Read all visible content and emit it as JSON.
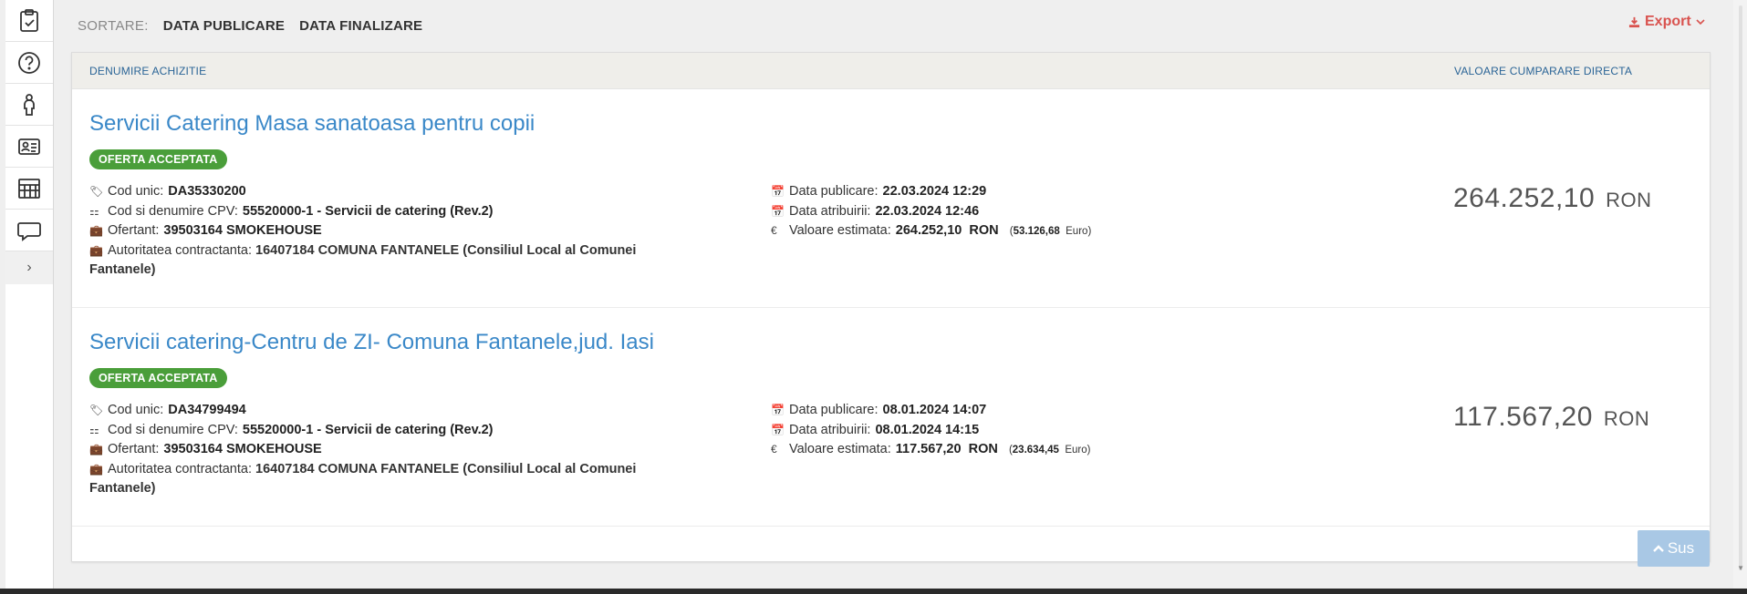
{
  "sidebar": {
    "items": [
      {
        "icon": "clipboard-check-icon"
      },
      {
        "icon": "help-circle-icon"
      },
      {
        "icon": "person-icon"
      },
      {
        "icon": "id-card-icon"
      },
      {
        "icon": "calendar-grid-icon"
      },
      {
        "icon": "chat-bubble-icon"
      }
    ],
    "toggle": "›"
  },
  "sort": {
    "label": "SORTARE:",
    "options": [
      "DATA PUBLICARE",
      "DATA FINALIZARE"
    ]
  },
  "export": {
    "label": "Export",
    "color": "#d9534f"
  },
  "table": {
    "col_name": "DENUMIRE ACHIZITIE",
    "col_value": "VALOARE CUMPARARE DIRECTA"
  },
  "rows": [
    {
      "title": "Servicii Catering Masa sanatoasa pentru copii",
      "status": "OFERTA ACCEPTATA",
      "cod_label": "Cod unic:",
      "cod": "DA35330200",
      "cpv_label": "Cod si denumire CPV:",
      "cpv": "55520000-1 - Servicii de catering (Rev.2)",
      "ofertant_label": "Ofertant:",
      "ofertant": "39503164 SMOKEHOUSE",
      "autoritate_label": "Autoritatea contractanta:",
      "autoritate": "16407184 COMUNA FANTANELE (Consiliul Local al Comunei Fantanele)",
      "publicare_label": "Data publicare:",
      "publicare": "22.03.2024 12:29",
      "atribuire_label": "Data atribuirii:",
      "atribuire": "22.03.2024 12:46",
      "valoare_label": "Valoare estimata:",
      "valoare": "264.252,10",
      "valoare_cur": "RON",
      "valoare_euro": "53.126,68",
      "euro_label": "Euro",
      "price": "264.252,10",
      "price_cur": "RON"
    },
    {
      "title": "Servicii catering-Centru de ZI- Comuna Fantanele,jud. Iasi",
      "status": "OFERTA ACCEPTATA",
      "cod_label": "Cod unic:",
      "cod": "DA34799494",
      "cpv_label": "Cod si denumire CPV:",
      "cpv": "55520000-1 - Servicii de catering (Rev.2)",
      "ofertant_label": "Ofertant:",
      "ofertant": "39503164 SMOKEHOUSE",
      "autoritate_label": "Autoritatea contractanta:",
      "autoritate": "16407184 COMUNA FANTANELE (Consiliul Local al Comunei Fantanele)",
      "publicare_label": "Data publicare:",
      "publicare": "08.01.2024 14:07",
      "atribuire_label": "Data atribuirii:",
      "atribuire": "08.01.2024 14:15",
      "valoare_label": "Valoare estimata:",
      "valoare": "117.567,20",
      "valoare_cur": "RON",
      "valoare_euro": "23.634,45",
      "euro_label": "Euro",
      "price": "117.567,20",
      "price_cur": "RON"
    }
  ],
  "back_to_top": "Sus"
}
